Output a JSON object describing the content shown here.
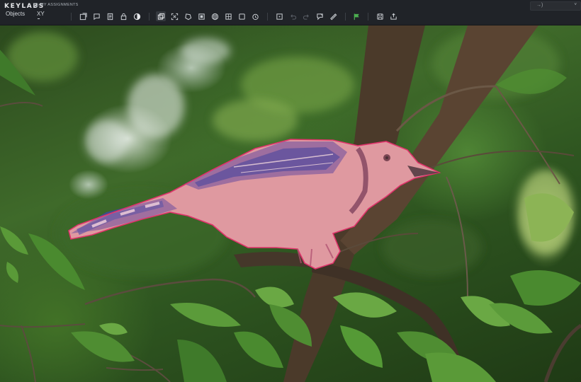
{
  "app": {
    "brand": "KEYLABS",
    "assignments_label": "MY ASSIGNMENTS"
  },
  "panel": {
    "objects_tab": "Objects",
    "xy_tab": "XY"
  },
  "toolbar": {
    "tools": [
      "select-icon",
      "comment-icon",
      "document-icon",
      "lock-icon",
      "contrast-icon",
      "copy-icon",
      "fit-icon",
      "polygon-icon",
      "box-tool-icon",
      "pattern-icon",
      "target-icon",
      "square-icon",
      "timer-icon",
      "crosshair-icon",
      "undo-icon",
      "redo-icon",
      "tag-icon",
      "ruler-icon",
      "flag-icon",
      "save-icon",
      "export-icon"
    ],
    "active_tool": "copy-icon",
    "accent_color": "#4caf50"
  },
  "header_right": {
    "label": "→)",
    "chevron": "˅"
  },
  "annotation": {
    "label": "bird",
    "outline_color": "#e0336b",
    "fill_color": "#f08cae"
  }
}
